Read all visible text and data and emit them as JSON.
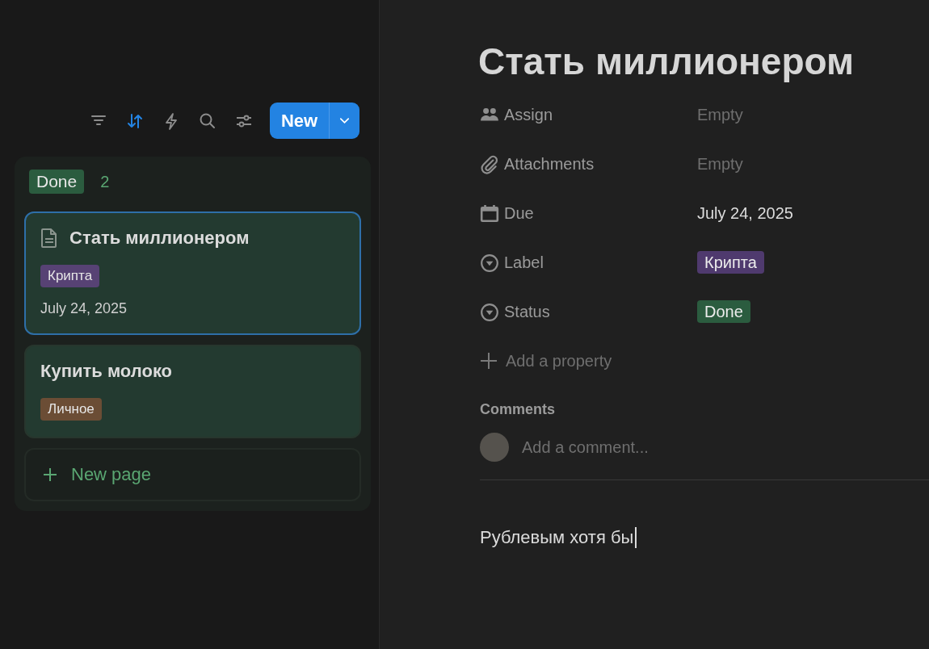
{
  "toolbar": {
    "icons": [
      {
        "kind": "filter",
        "active": false
      },
      {
        "kind": "sort",
        "active": true
      },
      {
        "kind": "automation",
        "active": false
      },
      {
        "kind": "search",
        "active": false
      },
      {
        "kind": "settings",
        "active": false
      }
    ],
    "new_button": "New"
  },
  "board": {
    "group": {
      "status": "Done",
      "color": "#2b5c3f",
      "count": "2"
    },
    "cards": [
      {
        "title": "Стать миллионером",
        "kind": "page",
        "selected": true,
        "tag": {
          "text": "Крипта",
          "color": "#574274"
        },
        "date": "July 24, 2025"
      },
      {
        "title": "Купить молоко",
        "kind": "plain",
        "selected": false,
        "tag": {
          "text": "Личное",
          "color": "#6b4d35"
        }
      }
    ],
    "new_page": "New page"
  },
  "page": {
    "title": "Стать миллионером",
    "properties": [
      {
        "kind": "people",
        "label": "Assign",
        "placeholder": "Empty"
      },
      {
        "kind": "paperclip",
        "label": "Attachments",
        "placeholder": "Empty"
      },
      {
        "kind": "calendar",
        "label": "Due",
        "value": "July 24, 2025"
      },
      {
        "kind": "circle-caret",
        "label": "Label",
        "value": "Крипта",
        "color": "#4f3a6e"
      },
      {
        "kind": "circle-caret",
        "label": "Status",
        "value": "Done",
        "color": "#2b5c3f"
      }
    ],
    "add_property": "Add a property",
    "comments": {
      "heading": "Comments",
      "placeholder": "Add a comment..."
    },
    "body": {
      "text": "Рублевым хотя бы",
      "focused": true
    }
  }
}
